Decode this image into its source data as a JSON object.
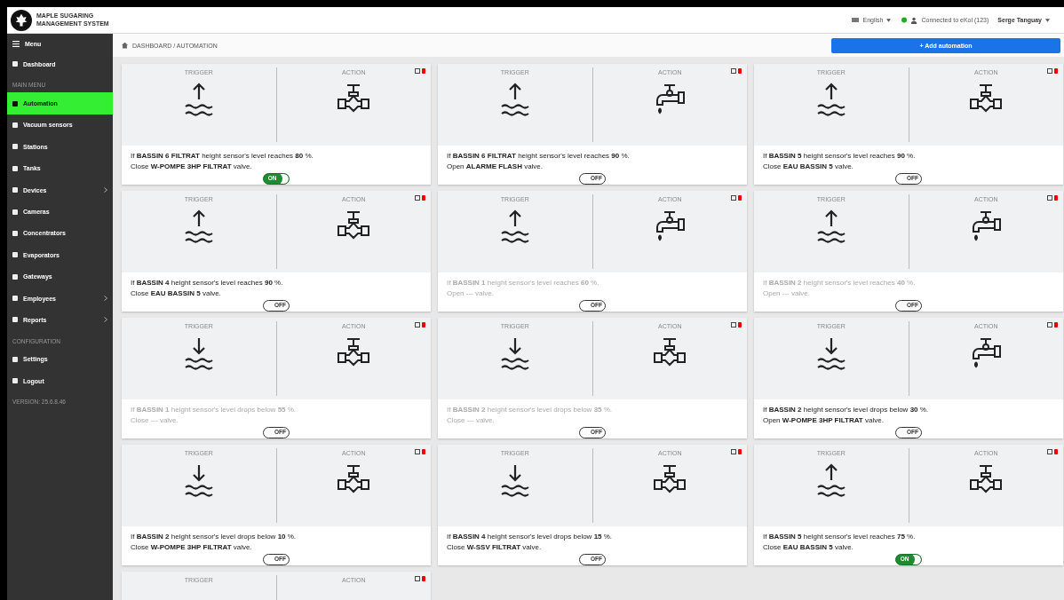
{
  "header": {
    "logo_text": "MAPLE SUGARING\nMANAGEMENT SYSTEM",
    "language": "English",
    "connection": "Connected to eKol (123)",
    "user": "Serge Tanguay"
  },
  "sidebar": {
    "menu_label": "Menu",
    "items": [
      {
        "kind": "item",
        "label": "Dashboard",
        "selected": false,
        "submenu": false
      },
      {
        "kind": "section",
        "label": "MAIN MENU"
      },
      {
        "kind": "item",
        "label": "Automation",
        "selected": true,
        "submenu": false
      },
      {
        "kind": "item",
        "label": "Vacuum sensors",
        "selected": false,
        "submenu": false
      },
      {
        "kind": "item",
        "label": "Stations",
        "selected": false,
        "submenu": false
      },
      {
        "kind": "item",
        "label": "Tanks",
        "selected": false,
        "submenu": false
      },
      {
        "kind": "item",
        "label": "Devices",
        "selected": false,
        "submenu": true
      },
      {
        "kind": "item",
        "label": "Cameras",
        "selected": false,
        "submenu": false
      },
      {
        "kind": "item",
        "label": "Concentrators",
        "selected": false,
        "submenu": false
      },
      {
        "kind": "item",
        "label": "Evaporators",
        "selected": false,
        "submenu": false
      },
      {
        "kind": "item",
        "label": "Gateways",
        "selected": false,
        "submenu": false
      },
      {
        "kind": "item",
        "label": "Employees",
        "selected": false,
        "submenu": true
      },
      {
        "kind": "item",
        "label": "Reports",
        "selected": false,
        "submenu": true
      },
      {
        "kind": "section",
        "label": "CONFIGURATION"
      },
      {
        "kind": "item",
        "label": "Settings",
        "selected": false,
        "submenu": false
      },
      {
        "kind": "item",
        "label": "Logout",
        "selected": false,
        "submenu": false
      },
      {
        "kind": "section",
        "label": "VERSION: 25.6.8.46"
      }
    ]
  },
  "breadcrumb": "DASHBOARD / AUTOMATION",
  "add_button": "+ Add automation",
  "cards": [
    {
      "trigger": {
        "label": "TRIGGER",
        "kind": "rise"
      },
      "action": {
        "label": "ACTION",
        "kind": "valve"
      },
      "disabled": false,
      "on": true,
      "toggle_label": "ON",
      "line1": "If **BASSIN 6 FILTRAT** height sensor's level reaches **80** %.",
      "line2": "Close **W-POMPE 3HP FILTRAT** valve."
    },
    {
      "trigger": {
        "label": "TRIGGER",
        "kind": "rise"
      },
      "action": {
        "label": "ACTION",
        "kind": "faucet"
      },
      "disabled": false,
      "on": false,
      "toggle_label": "OFF",
      "line1": "If **BASSIN 6 FILTRAT** height sensor's level reaches **90** %.",
      "line2": "Open **ALARME FLASH** valve."
    },
    {
      "trigger": {
        "label": "TRIGGER",
        "kind": "rise"
      },
      "action": {
        "label": "ACTION",
        "kind": "valve"
      },
      "disabled": false,
      "on": false,
      "toggle_label": "OFF",
      "line1": "If **BASSIN 5** height sensor's level reaches **90** %.",
      "line2": "Close **EAU BASSIN 5** valve."
    },
    {
      "trigger": {
        "label": "TRIGGER",
        "kind": "rise"
      },
      "action": {
        "label": "ACTION",
        "kind": "valve"
      },
      "disabled": false,
      "on": false,
      "toggle_label": "OFF",
      "line1": "If **BASSIN 4** height sensor's level reaches **90** %.",
      "line2": "Close **EAU BASSIN 5** valve."
    },
    {
      "trigger": {
        "label": "TRIGGER",
        "kind": "rise"
      },
      "action": {
        "label": "ACTION",
        "kind": "faucet"
      },
      "disabled": true,
      "on": false,
      "toggle_label": "OFF",
      "line1": "If **BASSIN 1** height sensor's level reaches **60** %.",
      "line2": "Open --- valve."
    },
    {
      "trigger": {
        "label": "TRIGGER",
        "kind": "rise"
      },
      "action": {
        "label": "ACTION",
        "kind": "faucet"
      },
      "disabled": true,
      "on": false,
      "toggle_label": "OFF",
      "line1": "If **BASSIN 2** height sensor's level reaches **40** %.",
      "line2": "Open --- valve."
    },
    {
      "trigger": {
        "label": "TRIGGER",
        "kind": "drop"
      },
      "action": {
        "label": "ACTION",
        "kind": "valve"
      },
      "disabled": true,
      "on": false,
      "toggle_label": "OFF",
      "line1": "If **BASSIN 1** height sensor's level drops below **55** %.",
      "line2": "Close --- valve."
    },
    {
      "trigger": {
        "label": "TRIGGER",
        "kind": "drop"
      },
      "action": {
        "label": "ACTION",
        "kind": "valve"
      },
      "disabled": true,
      "on": false,
      "toggle_label": "OFF",
      "line1": "If **BASSIN 2** height sensor's level drops below **35** %.",
      "line2": "Close --- valve."
    },
    {
      "trigger": {
        "label": "TRIGGER",
        "kind": "drop"
      },
      "action": {
        "label": "ACTION",
        "kind": "faucet"
      },
      "disabled": false,
      "on": false,
      "toggle_label": "OFF",
      "line1": "If **BASSIN 2** height sensor's level drops below **30** %.",
      "line2": "Open **W-POMPE 3HP FILTRAT** valve."
    },
    {
      "trigger": {
        "label": "TRIGGER",
        "kind": "drop"
      },
      "action": {
        "label": "ACTION",
        "kind": "valve"
      },
      "disabled": false,
      "on": false,
      "toggle_label": "OFF",
      "line1": "If **BASSIN 2** height sensor's level drops below **10** %.",
      "line2": "Close **W-POMPE 3HP FILTRAT** valve."
    },
    {
      "trigger": {
        "label": "TRIGGER",
        "kind": "drop"
      },
      "action": {
        "label": "ACTION",
        "kind": "valve"
      },
      "disabled": false,
      "on": false,
      "toggle_label": "OFF",
      "line1": "If **BASSIN 4** height sensor's level drops below **15** %.",
      "line2": "Close **W-SSV FILTRAT** valve."
    },
    {
      "trigger": {
        "label": "TRIGGER",
        "kind": "rise"
      },
      "action": {
        "label": "ACTION",
        "kind": "valve"
      },
      "disabled": false,
      "on": true,
      "toggle_label": "ON",
      "line1": "If **BASSIN 5** height sensor's level reaches **75** %.",
      "line2": "Close **EAU BASSIN 5** valve."
    },
    {
      "trigger": {
        "label": "TRIGGER",
        "kind": "cut"
      },
      "action": {
        "label": "ACTION",
        "kind": "cut"
      }
    }
  ]
}
